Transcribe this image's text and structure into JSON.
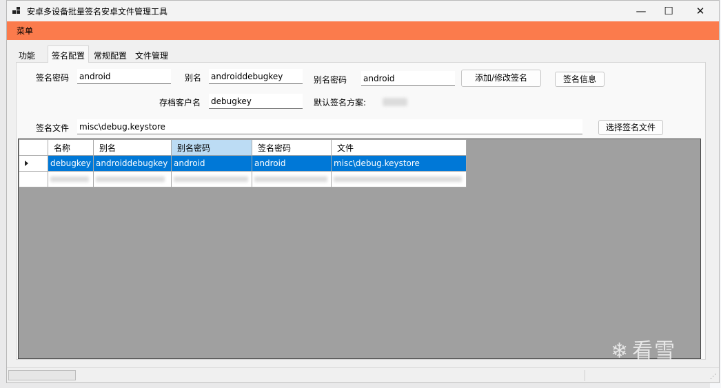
{
  "window": {
    "title": "安卓多设备批量签名安卓文件管理工具"
  },
  "menubar": {
    "menu_label": "菜单"
  },
  "tabs": [
    {
      "label": "功能"
    },
    {
      "label": "签名配置"
    },
    {
      "label": "常规配置"
    },
    {
      "label": "文件管理"
    }
  ],
  "form": {
    "sign_password_label": "签名密码",
    "sign_password_value": "android",
    "alias_label": "别名",
    "alias_value": "androiddebugkey",
    "alias_password_label": "别名密码",
    "alias_password_value": "android",
    "add_modify_button": "添加/修改签名",
    "sign_info_button": "签名信息",
    "archive_client_label": "存档客户名",
    "archive_client_value": "debugkey",
    "default_scheme_label": "默认签名方案:",
    "sign_file_label": "签名文件",
    "sign_file_value": "misc\\debug.keystore",
    "choose_file_button": "选择签名文件"
  },
  "grid": {
    "columns": [
      "名称",
      "别名",
      "别名密码",
      "签名密码",
      "文件"
    ],
    "rows": [
      {
        "name": "debugkey",
        "alias": "androiddebugkey",
        "alias_password": "android",
        "sign_password": "android",
        "file": "misc\\debug.keystore"
      }
    ]
  },
  "watermark": {
    "text": "看雪"
  },
  "colors": {
    "menubar": "#fb7b4c",
    "selection": "#0078d7",
    "selected_header": "#bcdcf4",
    "grid_background": "#a0a0a0"
  },
  "icons": {
    "minimize": "minimize-icon",
    "maximize": "maximize-icon",
    "close": "close-icon",
    "row_pointer": "row-pointer-icon"
  }
}
